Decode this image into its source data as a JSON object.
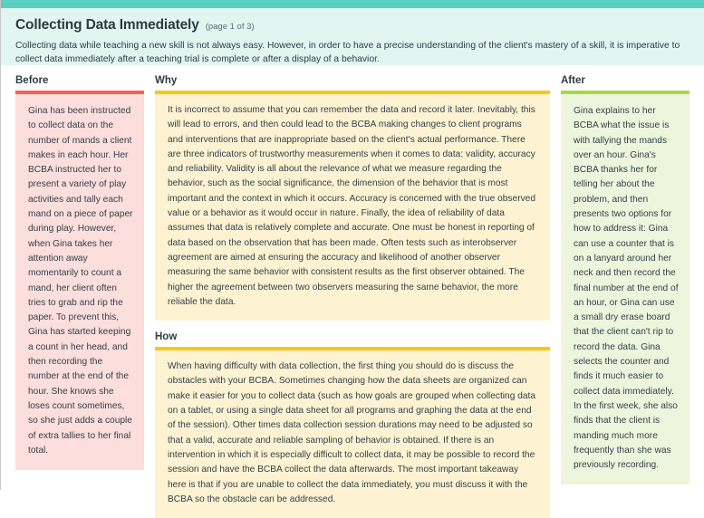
{
  "theme": {
    "strip_color": "#5ad0c3",
    "header_bg": "#e3f5f1",
    "before_accent": "#f96050",
    "before_bg": "#fcdedc",
    "why_accent": "#fdc613",
    "why_bg": "#fdf3d2",
    "how_accent": "#fdc613",
    "how_bg": "#fdf3d2",
    "after_accent": "#a8d74a",
    "after_bg": "#edf6dc"
  },
  "header": {
    "title": "Collecting Data Immediately",
    "page_indicator": "(page 1 of 3)",
    "intro": "Collecting data while teaching a new skill is not always easy. However, in order to have a precise understanding of the client's mastery of a skill, it is imperative to collect data immediately after a teaching trial is complete or after a display of a behavior."
  },
  "sections": {
    "before": {
      "label": "Before",
      "body": "Gina has been instructed to collect data on the number of mands a client makes in each hour. Her BCBA instructed her to present a variety of play activities and tally each mand on a piece of paper during play. However, when Gina takes her attention away momentarily to count a mand, her client often tries to grab and rip the paper. To prevent this, Gina has started keeping a count in her head, and then recording the number at the end of the hour. She knows she loses count sometimes, so she just adds a couple of extra tallies to her final total."
    },
    "why": {
      "label": "Why",
      "body": "It is incorrect to assume that you can remember the data and record it later. Inevitably, this will lead to errors, and then could lead to the BCBA making changes to client programs and interventions that are inappropriate based on the client's actual performance. There are three indicators of trustworthy measurements when it comes to data: validity, accuracy and reliability. Validity is all about the relevance of what we measure regarding the behavior, such as the social significance, the dimension of the behavior that is most important and the context in which it occurs. Accuracy is concerned with the true observed value or a behavior as it would occur in nature. Finally, the idea of reliability of data assumes that data is relatively complete and accurate. One must be honest in reporting of data based on the observation that has been made. Often tests such as interobserver agreement are aimed at ensuring the accuracy and likelihood of another observer measuring the same behavior with consistent results as the first observer obtained. The higher the agreement between two observers measuring the same behavior, the more reliable the data."
    },
    "how": {
      "label": "How",
      "body": "When having difficulty with data collection, the first thing you should do is discuss the obstacles with your BCBA. Sometimes changing how the data sheets are organized can make it easier for you to collect data (such as how goals are grouped when collecting data on a tablet, or using a single data sheet for all programs and graphing the data at the end of the session). Other times data collection session durations may need to be adjusted so that a valid, accurate and reliable sampling of behavior is obtained. If there is an intervention in which it is especially difficult to collect data, it may be possible to record the session and have the BCBA collect the data afterwards. The most important takeaway here is that if you are unable to collect the data immediately, you must discuss it with the BCBA so the obstacle can be addressed."
    },
    "after": {
      "label": "After",
      "body": "Gina explains to her BCBA what the issue is with tallying the mands over an hour. Gina's BCBA thanks her for telling her about the problem, and then presents two options for how to address it: Gina can use a counter that is on a lanyard around her neck and then record the final number at the end of an hour, or Gina can use a small dry erase board that the client can't rip to record the data. Gina selects the counter and finds it much easier to collect data immediately. In the first week, she also finds that the client is manding much more frequently than she was previously recording."
    }
  }
}
